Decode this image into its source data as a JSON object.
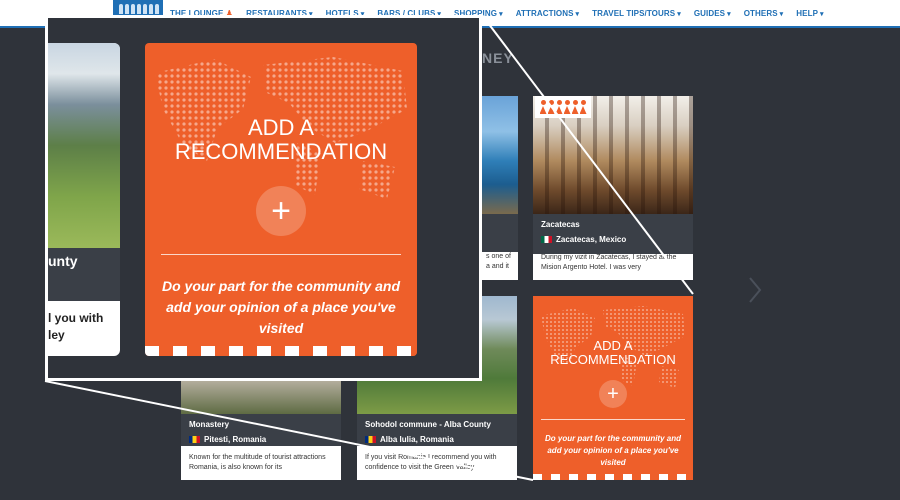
{
  "nav": {
    "items": [
      {
        "label": "THE LOUNGE",
        "icon": "lounge-figure-icon"
      },
      {
        "label": "RESTAURANTS",
        "caret": "▾"
      },
      {
        "label": "HOTELS",
        "caret": "▾"
      },
      {
        "label": "BARS / CLUBS",
        "caret": "▾"
      },
      {
        "label": "SHOPPING",
        "caret": "▾"
      },
      {
        "label": "ATTRACTIONS",
        "caret": "▾"
      },
      {
        "label": "TRAVEL TIPS/TOURS",
        "caret": "▾"
      },
      {
        "label": "GUIDES",
        "caret": "▾"
      },
      {
        "label": "OTHERS",
        "caret": "▾"
      },
      {
        "label": "HELP",
        "caret": "▾"
      }
    ]
  },
  "heading_fragment": "NEY",
  "cards": {
    "zacatecas": {
      "title": "Zacatecas",
      "location": "Zacatecas, Mexico",
      "description": "During my vizit in Zacatecas, I stayed at the Mision Argento Hotel. I was very",
      "flag": "mexico-flag-icon"
    },
    "monastery": {
      "title": "Monastery",
      "location": "Pitesti, Romania",
      "description": "Known for the multitude of tourist attractions Romania, is also known for its",
      "flag": "romania-flag-icon"
    },
    "sohodol": {
      "title": "Sohodol commune - Alba County",
      "location": "Alba Iulia, Romania",
      "description": "If you visit Romania I recommend you with confidence to visit the Green Valley",
      "flag": "romania-flag-icon"
    },
    "pool_fragment": {
      "line1": "s one of",
      "line2": "a and it"
    }
  },
  "recommendation": {
    "title_line1": "ADD A",
    "title_line2": "RECOMMENDATION",
    "plus": "+",
    "text": "Do your part for the community and add your opinion of a place you've visited"
  },
  "zoom_left": {
    "title_fragment": "unty",
    "desc_line1": "l you with",
    "desc_line2": "ley"
  },
  "colors": {
    "accent": "#ee5f2a",
    "nav_blue": "#1f6fb5",
    "background": "#2f333a",
    "info_bar": "#3a3f47"
  }
}
